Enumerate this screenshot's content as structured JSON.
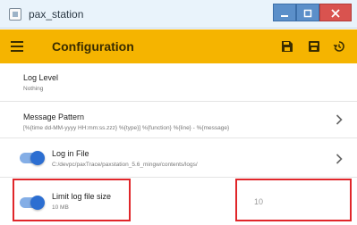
{
  "window": {
    "title": "pax_station",
    "icons": {
      "app": "app-logo-icon",
      "minimize": "minimize-icon",
      "maximize": "maximize-icon",
      "close": "close-icon"
    }
  },
  "appbar": {
    "title": "Configuration",
    "icons": {
      "menu": "hamburger-menu-icon",
      "save": "save-icon",
      "save_all": "save-all-icon",
      "restore": "restore-history-icon"
    },
    "accent_color": "#f5b400"
  },
  "settings": {
    "log_level": {
      "label": "Log Level",
      "value": "Nothing"
    },
    "message_pattern": {
      "label": "Message Pattern",
      "value": "[%{time dd-MM-yyyy HH:mm:ss.zzz} %{type}] %{function} %{line} - %{message}"
    },
    "log_in_file": {
      "label": "Log in File",
      "value": "C:/devpc/paxTrace/paxstation_5.6_mingw/contents/logs/",
      "enabled": true
    },
    "limit_log_file_size": {
      "label": "Limit log file size",
      "value": "10 MB",
      "enabled": true,
      "input_value": "10"
    }
  },
  "colors": {
    "toggle_on": "#2c6ed1",
    "highlight": "#e0262a"
  }
}
